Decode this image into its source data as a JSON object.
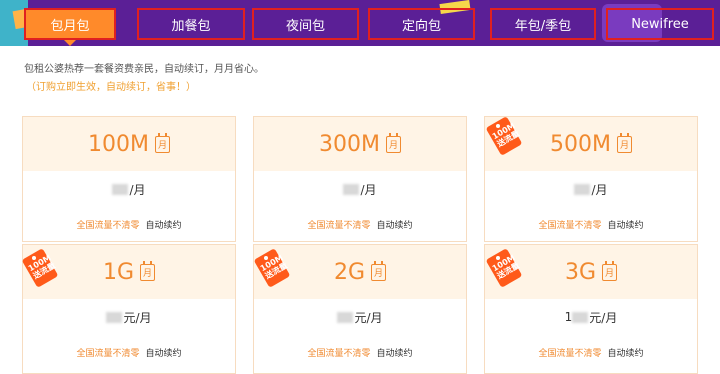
{
  "tabs": [
    {
      "label": "包月包",
      "active": true
    },
    {
      "label": "加餐包",
      "active": false
    },
    {
      "label": "夜间包",
      "active": false
    },
    {
      "label": "定向包",
      "active": false
    },
    {
      "label": "年包/季包",
      "active": false
    },
    {
      "label": "Newifree",
      "active": false
    }
  ],
  "description": "包租公婆热荐一套餐资费亲民，自动续订，月月省心。",
  "note": "（订购立即生效，自动续订，省事！）",
  "month_icon": "月",
  "price_unit": "元/月",
  "feature_highlight": "全国流量不清零",
  "feature_auto": "自动续约",
  "promo_tag": "100M 送流量",
  "plans": [
    {
      "size": "100M",
      "price_prefix": "",
      "price_unit": "/月",
      "tag": false
    },
    {
      "size": "300M",
      "price_prefix": "",
      "price_unit": "/月",
      "tag": false
    },
    {
      "size": "500M",
      "price_prefix": "",
      "price_unit": "/月",
      "tag": true
    },
    {
      "size": "1G",
      "price_prefix": "",
      "price_unit": "元/月",
      "tag": true
    },
    {
      "size": "2G",
      "price_prefix": "",
      "price_unit": "元/月",
      "tag": true
    },
    {
      "size": "3G",
      "price_prefix": "1",
      "price_unit": "元/月",
      "tag": true
    }
  ],
  "colors": {
    "topbar": "#5b1f96",
    "accent": "#f08a30",
    "tab_border": "#e02020"
  }
}
